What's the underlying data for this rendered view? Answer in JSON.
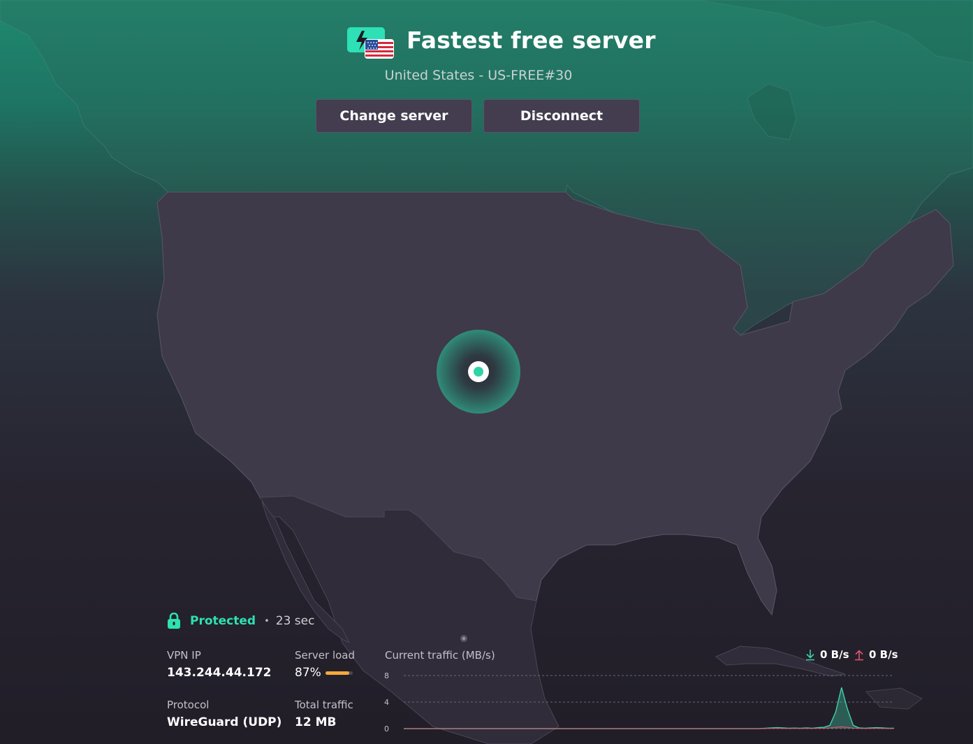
{
  "header": {
    "title": "Fastest free server",
    "subtitle": "United States - US-FREE#30",
    "change_server_label": "Change server",
    "disconnect_label": "Disconnect"
  },
  "status": {
    "state": "Protected",
    "separator": "•",
    "duration": "23 sec"
  },
  "stats": {
    "vpn_ip_label": "VPN IP",
    "vpn_ip_value": "143.244.44.172",
    "server_load_label": "Server load",
    "server_load_value": "87%",
    "server_load_fraction": 0.87,
    "protocol_label": "Protocol",
    "protocol_value": "WireGuard (UDP)",
    "total_traffic_label": "Total traffic",
    "total_traffic_value": "12 MB"
  },
  "traffic": {
    "title": "Current traffic (MB/s)",
    "download_value": "0 B/s",
    "upload_value": "0 B/s"
  },
  "chart_data": {
    "type": "area",
    "title": "Current traffic (MB/s)",
    "yticks": [
      "8",
      "4",
      "0"
    ],
    "ylim": [
      0,
      8
    ],
    "grid": true,
    "series": [
      {
        "name": "download",
        "values": [
          0,
          0,
          0,
          0,
          0,
          0,
          0,
          0,
          0,
          0,
          0,
          0,
          0,
          0,
          0,
          0,
          0,
          0,
          0,
          0,
          0,
          0,
          0,
          0,
          0,
          0,
          0,
          0,
          0,
          0,
          0,
          0,
          0,
          0,
          0,
          0,
          0,
          0,
          0,
          0,
          0,
          0,
          0,
          0,
          0,
          0,
          0,
          0,
          0,
          0,
          0,
          0,
          0,
          0,
          0,
          0,
          0,
          0,
          0,
          0,
          0,
          0,
          0.05,
          0.1,
          0.15,
          0.1,
          0.05,
          0.08,
          0.05,
          0.1,
          0.05,
          0.15,
          0.2,
          0.5,
          2.5,
          6.2,
          3.0,
          0.5,
          0.1,
          0.05,
          0.1,
          0.15,
          0.1,
          0.05,
          0.05
        ]
      },
      {
        "name": "upload",
        "values": [
          0,
          0,
          0,
          0,
          0,
          0,
          0,
          0,
          0,
          0,
          0,
          0,
          0,
          0,
          0,
          0,
          0,
          0,
          0,
          0,
          0,
          0,
          0,
          0,
          0,
          0,
          0,
          0,
          0,
          0,
          0,
          0,
          0,
          0,
          0,
          0,
          0,
          0,
          0,
          0,
          0,
          0,
          0,
          0,
          0,
          0,
          0,
          0,
          0,
          0,
          0,
          0,
          0,
          0,
          0,
          0,
          0,
          0,
          0,
          0,
          0,
          0,
          0.02,
          0.04,
          0.05,
          0.03,
          0.02,
          0.03,
          0.02,
          0.04,
          0.02,
          0.05,
          0.06,
          0.1,
          0.2,
          0.3,
          0.2,
          0.08,
          0.04,
          0.02,
          0.03,
          0.05,
          0.03,
          0.02,
          0.02
        ]
      }
    ]
  },
  "icons": {
    "server": "bolt-with-us-flag-icon",
    "lock": "lock-icon",
    "download": "arrow-down-icon",
    "upload": "arrow-up-icon"
  },
  "colors": {
    "accent": "#2fe0b0",
    "load_bar": "#f2a93b",
    "upload_arrow": "#e0566b",
    "download_arrow": "#3fd2a9"
  }
}
